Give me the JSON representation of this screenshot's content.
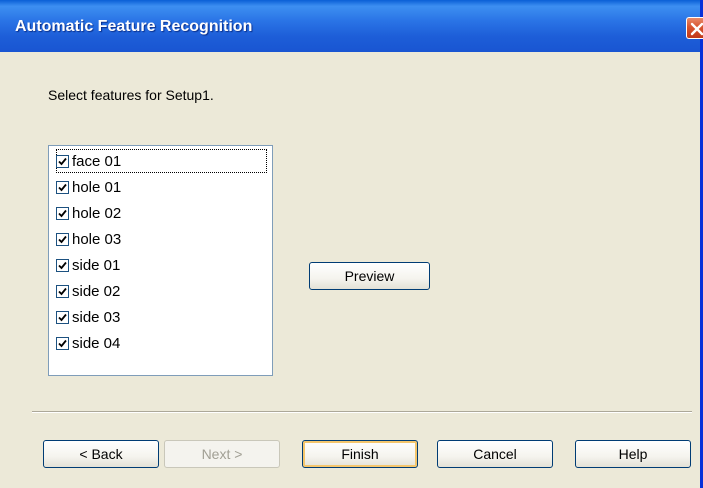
{
  "window": {
    "title": "Automatic Feature Recognition"
  },
  "instruction": "Select features for Setup1.",
  "features": [
    {
      "label": "face 01",
      "checked": true,
      "focused": true
    },
    {
      "label": "hole 01",
      "checked": true
    },
    {
      "label": "hole 02",
      "checked": true
    },
    {
      "label": "hole 03",
      "checked": true
    },
    {
      "label": "side 01",
      "checked": true
    },
    {
      "label": "side 02",
      "checked": true
    },
    {
      "label": "side 03",
      "checked": true
    },
    {
      "label": "side 04",
      "checked": true
    }
  ],
  "preview_label": "Preview",
  "buttons": {
    "back": "< Back",
    "next": "Next >",
    "finish": "Finish",
    "cancel": "Cancel",
    "help": "Help"
  },
  "colors": {
    "titlebar": "#0a5fd6",
    "close": "#d8542f",
    "face": "#ece9d8"
  }
}
